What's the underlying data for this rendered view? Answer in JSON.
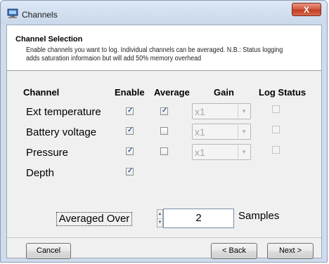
{
  "window": {
    "title": "Channels",
    "close_glyph": "X"
  },
  "header": {
    "title": "Channel Selection",
    "description": "Enable channels you want to log. Individual channels can be averaged. N.B.: Status logging adds saturation informaion but will add 50% memory overhead"
  },
  "columns": [
    "Channel",
    "Enable",
    "Average",
    "Gain",
    "Log Status"
  ],
  "channels": [
    {
      "name": "Ext temperature",
      "enable": true,
      "average": true,
      "gain": "x1",
      "log_status": false
    },
    {
      "name": "Battery voltage",
      "enable": true,
      "average": false,
      "gain": "x1",
      "log_status": false
    },
    {
      "name": "Pressure",
      "enable": true,
      "average": false,
      "gain": "x1",
      "log_status": false
    },
    {
      "name": "Depth",
      "enable": true
    }
  ],
  "averaging": {
    "label": "Averaged Over",
    "value": "2",
    "unit": "Samples"
  },
  "buttons": {
    "cancel": "Cancel",
    "back": "< Back",
    "next": "Next >"
  },
  "icons": {
    "check": "✓",
    "dropdown": "▼",
    "spin_up": "▲",
    "spin_down": "▼",
    "app": "computer-icon"
  }
}
